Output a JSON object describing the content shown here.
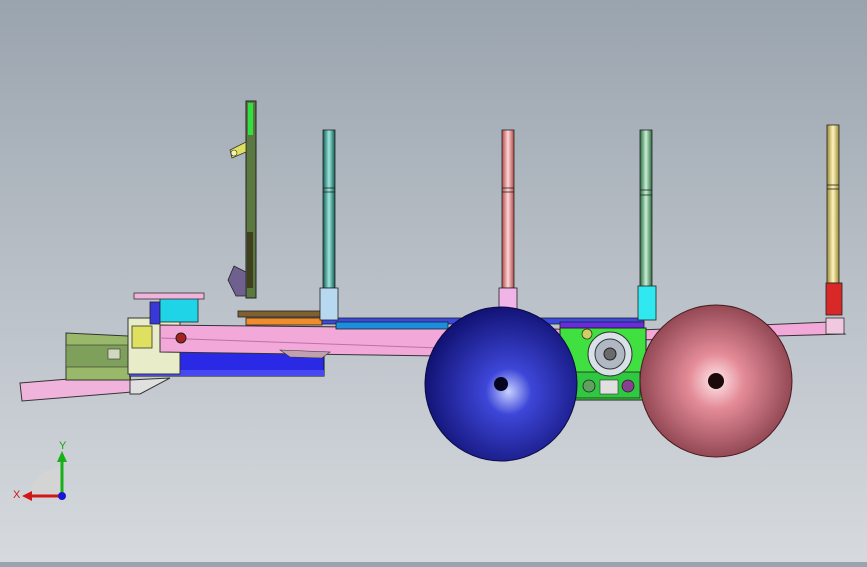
{
  "colors": {
    "background_top": "#9aa4ae",
    "background_bottom": "#d6dade",
    "frame_pink": "#f2b0d6",
    "frame_pink_dark": "#e07fc0",
    "wheel_front": "#1a1aa0",
    "wheel_rear": "#e0a0a8",
    "axis_x": "#d01818",
    "axis_y": "#18b018",
    "axis_z": "#1818d0"
  },
  "triad": {
    "x_label": "X",
    "y_label": "Y"
  }
}
